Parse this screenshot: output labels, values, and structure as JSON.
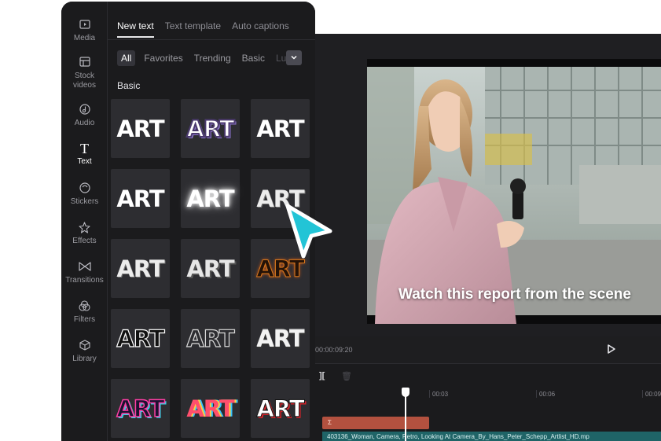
{
  "sidebar": {
    "items": [
      {
        "label": "Media",
        "icon": "media-icon"
      },
      {
        "label": "Stock\nvideos",
        "icon": "stock-videos-icon"
      },
      {
        "label": "Audio",
        "icon": "audio-icon"
      },
      {
        "label": "Text",
        "icon": "text-icon",
        "active": true
      },
      {
        "label": "Stickers",
        "icon": "stickers-icon"
      },
      {
        "label": "Effects",
        "icon": "effects-icon"
      },
      {
        "label": "Transitions",
        "icon": "transitions-icon"
      },
      {
        "label": "Filters",
        "icon": "filters-icon"
      },
      {
        "label": "Library",
        "icon": "library-icon"
      }
    ]
  },
  "text_panel": {
    "tabs": [
      "New text",
      "Text template",
      "Auto captions"
    ],
    "active_tab": "New text",
    "chips": [
      "All",
      "Favorites",
      "Trending",
      "Basic",
      "Lu"
    ],
    "active_chip": "All",
    "section_title": "Basic",
    "tile_label": "ART",
    "tile_count": 15
  },
  "preview": {
    "caption": "Watch this report from the scene",
    "current_time": "00:00:09:20"
  },
  "timeline": {
    "ticks": [
      "00:03",
      "00:06",
      "00:09"
    ],
    "text_clip_label": "Σ",
    "video_clip_label": "403136_Woman, Camera, Retro, Looking At Camera_By_Hans_Peter_Schepp_Artlist_HD.mp"
  },
  "colors": {
    "accent_cursor": "#22c4d6",
    "text_clip": "#b3513f",
    "video_clip": "#1f6467",
    "panel_bg": "#1b1b1d"
  }
}
